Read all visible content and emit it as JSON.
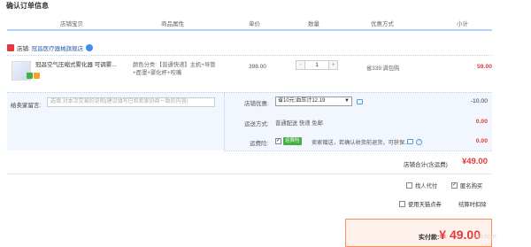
{
  "page": {
    "title": "确认订单信息"
  },
  "table_headers": {
    "shop_baby": "店铺宝贝",
    "attributes": "商品属性",
    "unit_price": "单价",
    "quantity": "数量",
    "discount": "优惠方式",
    "subtotal": "小计"
  },
  "shop": {
    "prefix": "店铺:",
    "name": "冠昌医疗器械旗舰店"
  },
  "item": {
    "title": "冠昌空气压缩式雾化器 可调雾...",
    "attributes": "颜色分类:【普通快递】主机+导管+面罩+雾化杯+咬嘴",
    "unit_price": "398.00",
    "quantity": "1",
    "qty_minus": "-",
    "qty_plus": "+",
    "discount": "省339:满包购",
    "subtotal": "59.00"
  },
  "message": {
    "label": "给卖家留言:",
    "placeholder": "选填:对本次交易的说明(建议填写已和卖家协商一致的内容)"
  },
  "options": {
    "shop_discount": {
      "label": "店铺优惠:",
      "selected": "省10元:血压计12.19",
      "value": "-10.00"
    },
    "shipping": {
      "label": "运送方式:",
      "method": "普通配送 快递 免邮",
      "value": "0.00"
    },
    "insurance": {
      "label": "运费险:",
      "badge": "运费险",
      "text": "卖家赠送，若确认收货前退货，可获保...",
      "value": "0.00",
      "help": "?"
    }
  },
  "shop_total": {
    "label": "店铺合计(含运费)",
    "value": "¥49.00"
  },
  "checkboxes": {
    "proxy_pay": "找人代付",
    "anonymous": "匿名购买",
    "tmall_points": "使用天猫点券",
    "points_deduct": "结算时扣除"
  },
  "payment": {
    "label": "实付款:",
    "value": "¥ 49.00"
  },
  "watermark": "ixia.com"
}
